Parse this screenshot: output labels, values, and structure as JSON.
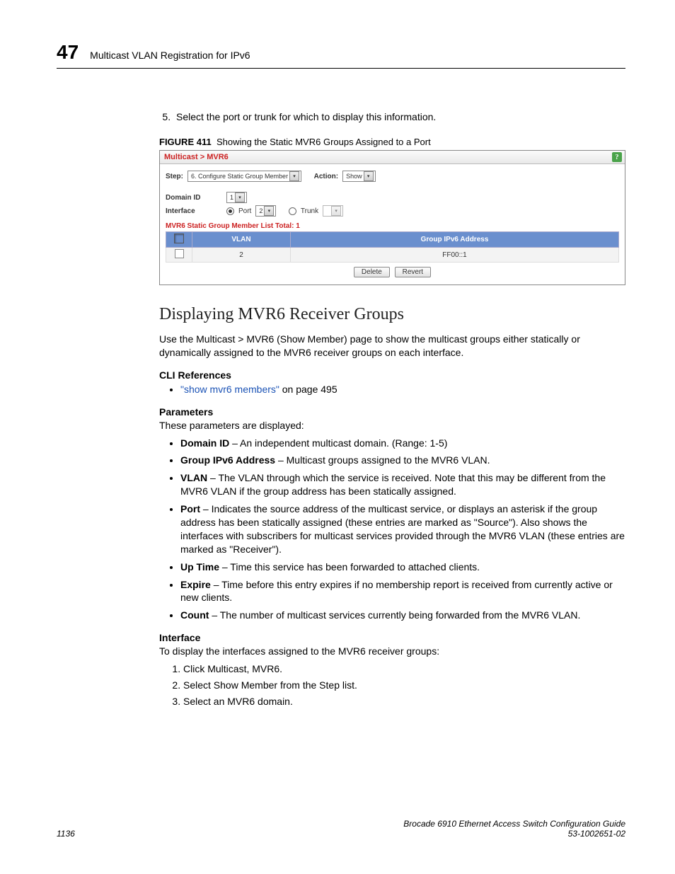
{
  "header": {
    "chapter_number": "47",
    "chapter_title": "Multicast VLAN Registration for IPv6"
  },
  "step5": {
    "num": "5.",
    "text": "Select the port or trunk for which to display this information."
  },
  "figcap": {
    "label": "FIGURE 411",
    "text": "Showing the Static MVR6 Groups Assigned to a Port"
  },
  "shot": {
    "breadcrumb": "Multicast > MVR6",
    "step_label": "Step:",
    "step_value": "6. Configure Static Group Member",
    "action_label": "Action:",
    "action_value": "Show",
    "domain_label": "Domain ID",
    "domain_value": "1",
    "iface_label": "Interface",
    "port_label": "Port",
    "port_value": "2",
    "trunk_label": "Trunk",
    "listtitle": "MVR6 Static Group Member List   Total: 1",
    "col_vlan": "VLAN",
    "col_addr": "Group IPv6 Address",
    "row_vlan": "2",
    "row_addr": "FF00::1",
    "btn_delete": "Delete",
    "btn_revert": "Revert"
  },
  "section_title": "Displaying MVR6 Receiver Groups",
  "intro": "Use the Multicast > MVR6 (Show Member) page to show the multicast groups either statically or dynamically assigned to the MVR6 receiver groups on each interface.",
  "cli_h": "CLI References",
  "cli_link": "\"show mvr6 members\"",
  "cli_tail": " on page 495",
  "param_h": "Parameters",
  "param_intro": "These parameters are displayed:",
  "params": {
    "p1_b": "Domain ID",
    "p1_t": " – An independent multicast domain. (Range: 1-5)",
    "p2_b": "Group IPv6 Address",
    "p2_t": " – Multicast groups assigned to the MVR6 VLAN.",
    "p3_b": "VLAN",
    "p3_t": " – The VLAN through which the service is received. Note that this may be different from the MVR6 VLAN if the group address has been statically assigned.",
    "p4_b": "Port",
    "p4_t": " – Indicates the source address of the multicast service, or displays an asterisk if the group address has been statically assigned (these entries are marked as \"Source\"). Also shows the interfaces with subscribers for multicast services provided through the MVR6 VLAN (these entries are marked as \"Receiver\").",
    "p5_b": "Up Time",
    "p5_t": " – Time this service has been forwarded to attached clients.",
    "p6_b": "Expire",
    "p6_t": " – Time before this entry expires if no membership report is received from currently active or new clients.",
    "p7_b": "Count",
    "p7_t": " – The number of multicast services currently being forwarded from the MVR6 VLAN."
  },
  "iface_h": "Interface",
  "iface_intro": "To display the interfaces assigned to the MVR6 receiver groups:",
  "steps": {
    "s1": "Click Multicast, MVR6.",
    "s2": "Select Show Member from the Step list.",
    "s3": "Select an MVR6 domain."
  },
  "footer": {
    "page": "1136",
    "doc": "Brocade 6910 Ethernet Access Switch Configuration Guide",
    "partno": "53-1002651-02"
  }
}
